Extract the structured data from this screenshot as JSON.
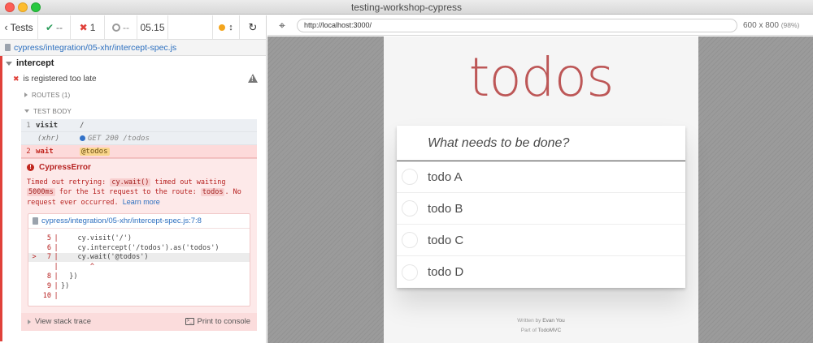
{
  "window": {
    "title": "testing-workshop-cypress"
  },
  "stats": {
    "tests_label": "Tests",
    "passed": "--",
    "failed": "1",
    "pending": "--",
    "duration": "05.15"
  },
  "spec": {
    "path": "cypress/integration/05-xhr/intercept-spec.js"
  },
  "suite": {
    "title": "intercept"
  },
  "test": {
    "title": "is registered too late"
  },
  "hooks": {
    "routes": "ROUTES (1)",
    "test_body": "TEST BODY"
  },
  "commands": [
    {
      "num": "1",
      "name": "visit",
      "message": "/"
    },
    {
      "num": "",
      "name": "(xhr)",
      "message": "GET 200 /todos"
    },
    {
      "num": "2",
      "name": "wait",
      "message": "@todos"
    }
  ],
  "error": {
    "name": "CypressError",
    "msg_1": "Timed out retrying: ",
    "code_1": "cy.wait()",
    "msg_2": " timed out waiting ",
    "code_2": "5000ms",
    "msg_3": " for the 1st request to the route: ",
    "code_3": "todos",
    "msg_4": ". No request ever occurred. ",
    "learn_more": "Learn more",
    "frame_file": "cypress/integration/05-xhr/intercept-spec.js:7:8",
    "code_lines": [
      {
        "arrow": "",
        "ln": "5",
        "text": "    cy.visit('/')"
      },
      {
        "arrow": "",
        "ln": "6",
        "text": "    cy.intercept('/todos').as('todos')"
      },
      {
        "arrow": ">",
        "ln": "7",
        "text": "    cy.wait('@todos')"
      },
      {
        "arrow": "",
        "ln": "",
        "text": "       ^"
      },
      {
        "arrow": "",
        "ln": "8",
        "text": "  })"
      },
      {
        "arrow": "",
        "ln": "9",
        "text": "})"
      },
      {
        "arrow": "",
        "ln": "10",
        "text": ""
      }
    ],
    "view_stack": "View stack trace",
    "print_console": "Print to console"
  },
  "preview": {
    "url": "http://localhost:3000/",
    "viewport": "600 x 800",
    "scale": "(98%)"
  },
  "app": {
    "title": "todos",
    "placeholder": "What needs to be done?",
    "todos": [
      "todo A",
      "todo B",
      "todo C",
      "todo D"
    ],
    "written_by_prefix": "Written by ",
    "author": "Evan You",
    "part_of_prefix": "Part of ",
    "project": "TodoMVC"
  },
  "colors": {
    "fail_red": "#e0413a",
    "link_blue": "#2c6fbf",
    "todo_title": "#af2f2f",
    "alias_bg": "#f9d58b"
  }
}
